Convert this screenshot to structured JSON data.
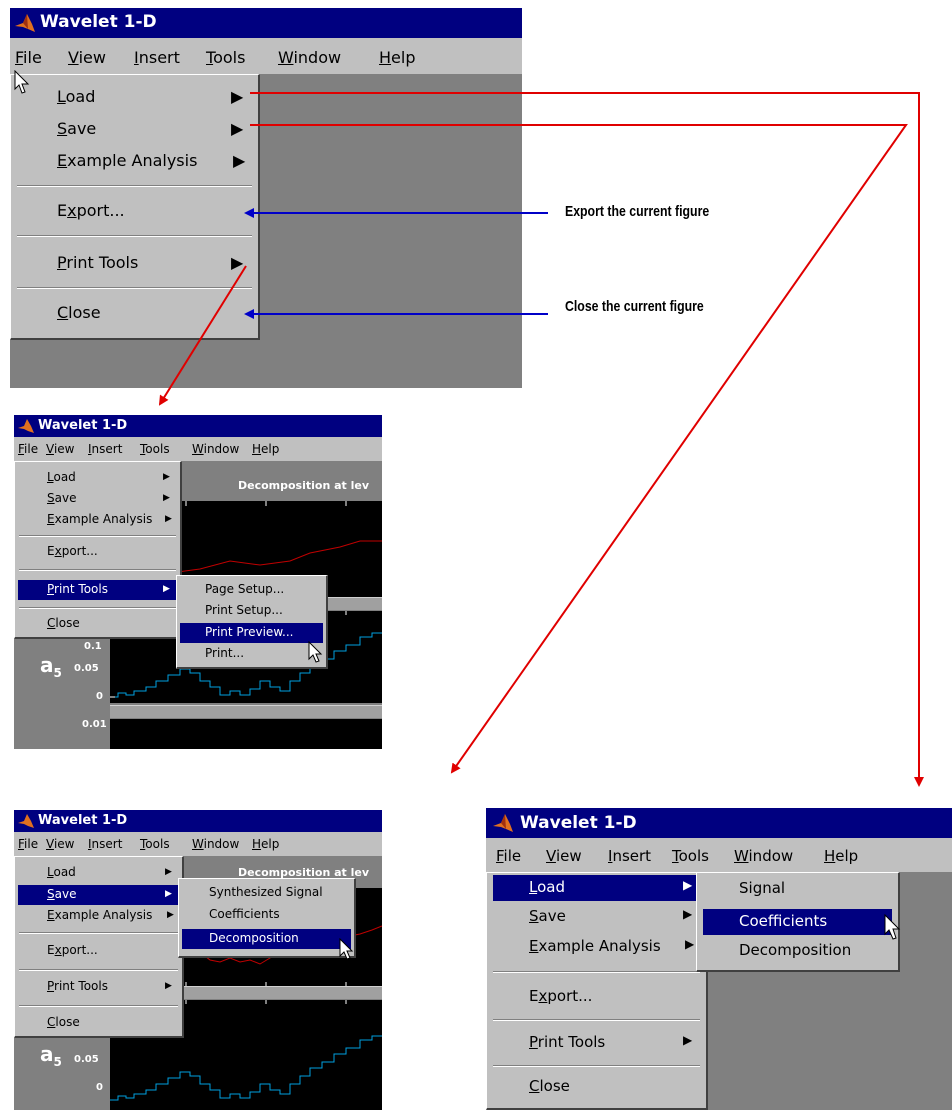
{
  "app_title": "Wavelet 1-D",
  "menubar": [
    "File",
    "View",
    "Insert",
    "Tools",
    "Window",
    "Help"
  ],
  "file_menu": {
    "load": "Load",
    "save": "Save",
    "example_analysis": "Example Analysis",
    "export": "Export...",
    "print_tools": "Print Tools",
    "close": "Close"
  },
  "print_tools_submenu": [
    "Page Setup...",
    "Print Setup...",
    "Print Preview...",
    "Print..."
  ],
  "save_submenu": [
    "Synthesized Signal",
    "Coefficients",
    "Decomposition"
  ],
  "load_submenu": [
    "Signal",
    "Coefficients",
    "Decomposition"
  ],
  "annotations": {
    "export": "Export the current figure",
    "close": "Close the current figure"
  },
  "plot_text": {
    "decomposition_title_1": "Decomposition at lev",
    "decomposition_title_2": "Decomposition at lev",
    "a5_label": "a",
    "a5_sub": "5",
    "y_ticks": [
      "0.1",
      "0.05",
      "0",
      "0.01"
    ]
  },
  "colors": {
    "title_bar": "#000080",
    "menu_bg": "#c0c0c0",
    "highlight": "#000080",
    "workspace": "#808080",
    "arrow_red": "#e00000",
    "arrow_blue": "#0000c8",
    "signal_red": "#c00000",
    "signal_cyan": "#00a0e0"
  }
}
